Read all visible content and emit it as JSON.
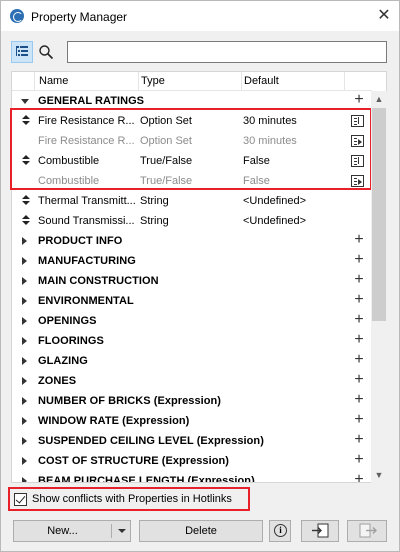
{
  "window": {
    "title": "Property Manager",
    "close_glyph": "✕"
  },
  "search": {
    "placeholder": "",
    "value": ""
  },
  "columns": {
    "name": "Name",
    "type": "Type",
    "default": "Default"
  },
  "rows": [
    {
      "kind": "group",
      "label": "GENERAL RATINGS",
      "expanded": true
    },
    {
      "kind": "prop",
      "name": "Fire Resistance R...",
      "type": "Option Set",
      "default": "30 minutes",
      "muted": false,
      "icon": "property-in-icon"
    },
    {
      "kind": "prop",
      "name": "Fire Resistance R...",
      "type": "Option Set",
      "default": "30 minutes",
      "muted": true,
      "icon": "property-out-icon"
    },
    {
      "kind": "prop",
      "name": "Combustible",
      "type": "True/False",
      "default": "False",
      "muted": false,
      "icon": "property-in-icon"
    },
    {
      "kind": "prop",
      "name": "Combustible",
      "type": "True/False",
      "default": "False",
      "muted": true,
      "icon": "property-out-icon"
    },
    {
      "kind": "prop",
      "name": "Thermal Transmitt...",
      "type": "String",
      "default": "<Undefined>",
      "muted": false
    },
    {
      "kind": "prop",
      "name": "Sound Transmissi...",
      "type": "String",
      "default": "<Undefined>",
      "muted": false
    },
    {
      "kind": "group",
      "label": "PRODUCT INFO"
    },
    {
      "kind": "group",
      "label": "MANUFACTURING"
    },
    {
      "kind": "group",
      "label": "MAIN CONSTRUCTION"
    },
    {
      "kind": "group",
      "label": "ENVIRONMENTAL"
    },
    {
      "kind": "group",
      "label": "OPENINGS"
    },
    {
      "kind": "group",
      "label": "FLOORINGS"
    },
    {
      "kind": "group",
      "label": "GLAZING"
    },
    {
      "kind": "group",
      "label": "ZONES"
    },
    {
      "kind": "group",
      "label": "NUMBER OF BRICKS (Expression)"
    },
    {
      "kind": "group",
      "label": "WINDOW RATE (Expression)"
    },
    {
      "kind": "group",
      "label": "SUSPENDED CEILING LEVEL (Expression)"
    },
    {
      "kind": "group",
      "label": "COST OF STRUCTURE (Expression)"
    },
    {
      "kind": "group",
      "label": "BEAM PURCHASE LENGTH (Expression)"
    }
  ],
  "footer": {
    "conflicts_label": "Show conflicts with Properties in Hotlinks",
    "conflicts_checked": true,
    "new_label": "New...",
    "delete_label": "Delete",
    "info_glyph": "i"
  },
  "colors": {
    "highlight": "#e8202a",
    "selected_tool": "#cce4f7"
  }
}
